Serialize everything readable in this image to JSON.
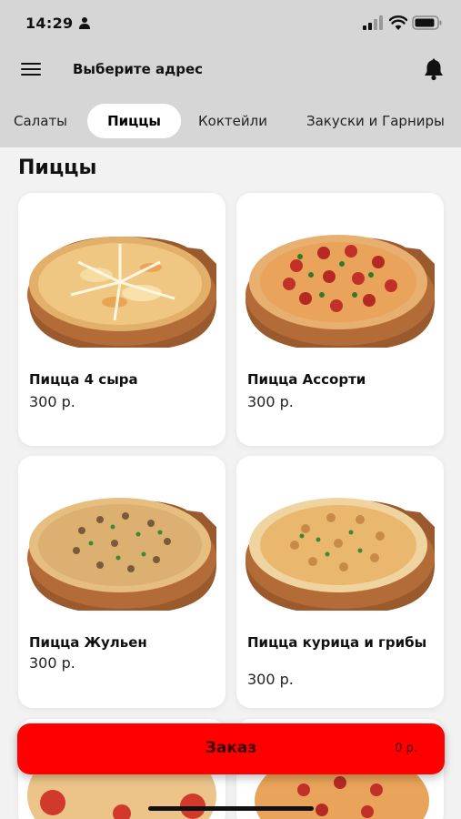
{
  "status_bar": {
    "time": "14:29"
  },
  "header": {
    "address_title": "Выберите адрес"
  },
  "tabs": [
    {
      "label": "Салаты",
      "active": false
    },
    {
      "label": "Пиццы",
      "active": true
    },
    {
      "label": "Коктейли",
      "active": false
    },
    {
      "label": "Закуски и Гарниры",
      "active": false
    }
  ],
  "section": {
    "title": "Пиццы"
  },
  "products": [
    {
      "name": "Пицца 4 сыра",
      "price": "300 р.",
      "image": "four-cheese-pizza"
    },
    {
      "name": "Пицца Ассорти",
      "price": "300 р.",
      "image": "assorted-pizza"
    },
    {
      "name": "Пицца Жульен",
      "price": "300 р.",
      "image": "julienne-pizza"
    },
    {
      "name": "Пицца курица и грибы",
      "price": "300 р.",
      "image": "chicken-mushroom-pizza"
    }
  ],
  "order": {
    "label": "Заказ",
    "total": "0 р."
  },
  "colors": {
    "accent": "#ff0000",
    "header_bg": "#d6d6d6",
    "page_bg": "#f2f2f2"
  }
}
